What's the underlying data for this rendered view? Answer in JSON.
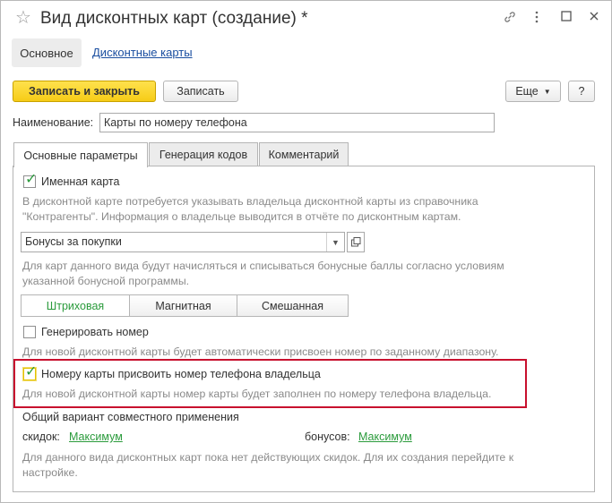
{
  "window": {
    "title": "Вид дисконтных карт (создание) *",
    "star_icon": "star-icon",
    "controls": [
      "link-icon",
      "more-icon",
      "maximize-icon",
      "close-icon"
    ]
  },
  "nav": {
    "main_tab": "Основное",
    "cards_link": "Дисконтные карты"
  },
  "toolbar": {
    "save_close": "Записать и закрыть",
    "save": "Записать",
    "more": "Еще",
    "help": "?"
  },
  "name_field": {
    "label": "Наименование:",
    "value": "Карты по номеру телефона"
  },
  "tabs": [
    {
      "label": "Основные параметры",
      "active": true
    },
    {
      "label": "Генерация кодов",
      "active": false
    },
    {
      "label": "Комментарий",
      "active": false
    }
  ],
  "main": {
    "named_card": {
      "label": "Именная карта",
      "checked": true,
      "note_line1": "В дисконтной карте потребуется указывать владельца дисконтной карты из справочника",
      "note_line2": "\"Контрагенты\". Информация о владельце выводится в отчёте по дисконтным картам."
    },
    "bonus_select": {
      "value": "Бонусы за покупки",
      "note_line1": "Для карт данного вида будут начисляться и списываться бонусные баллы согласно условиям",
      "note_line2": "указанной бонусной программы."
    },
    "card_type": {
      "options": [
        "Штриховая",
        "Магнитная",
        "Смешанная"
      ],
      "selected": "Штриховая"
    },
    "generate_number": {
      "label": "Генерировать номер",
      "checked": false,
      "note": "Для новой дисконтной карты будет автоматически присвоен номер по заданному диапазону."
    },
    "phone_number": {
      "label": "Номеру карты присвоить номер телефона владельца",
      "checked": true,
      "note": "Для новой дисконтной карты номер карты будет заполнен по номеру телефона владельца."
    },
    "combined": {
      "heading": "Общий вариант совместного применения",
      "discounts_label": "скидок:",
      "discounts_value": "Максимум",
      "bonuses_label": "бонусов:",
      "bonuses_value": "Максимум",
      "note_line1": "Для данного вида дисконтных карт пока нет действующих скидок. Для их создания перейдите к",
      "note_line2": "настройке."
    }
  },
  "colors": {
    "primary_button": "#f6cc16",
    "green_accent": "#2b9b3c",
    "highlight_frame": "#c8102e",
    "link": "#1a4ea0"
  }
}
